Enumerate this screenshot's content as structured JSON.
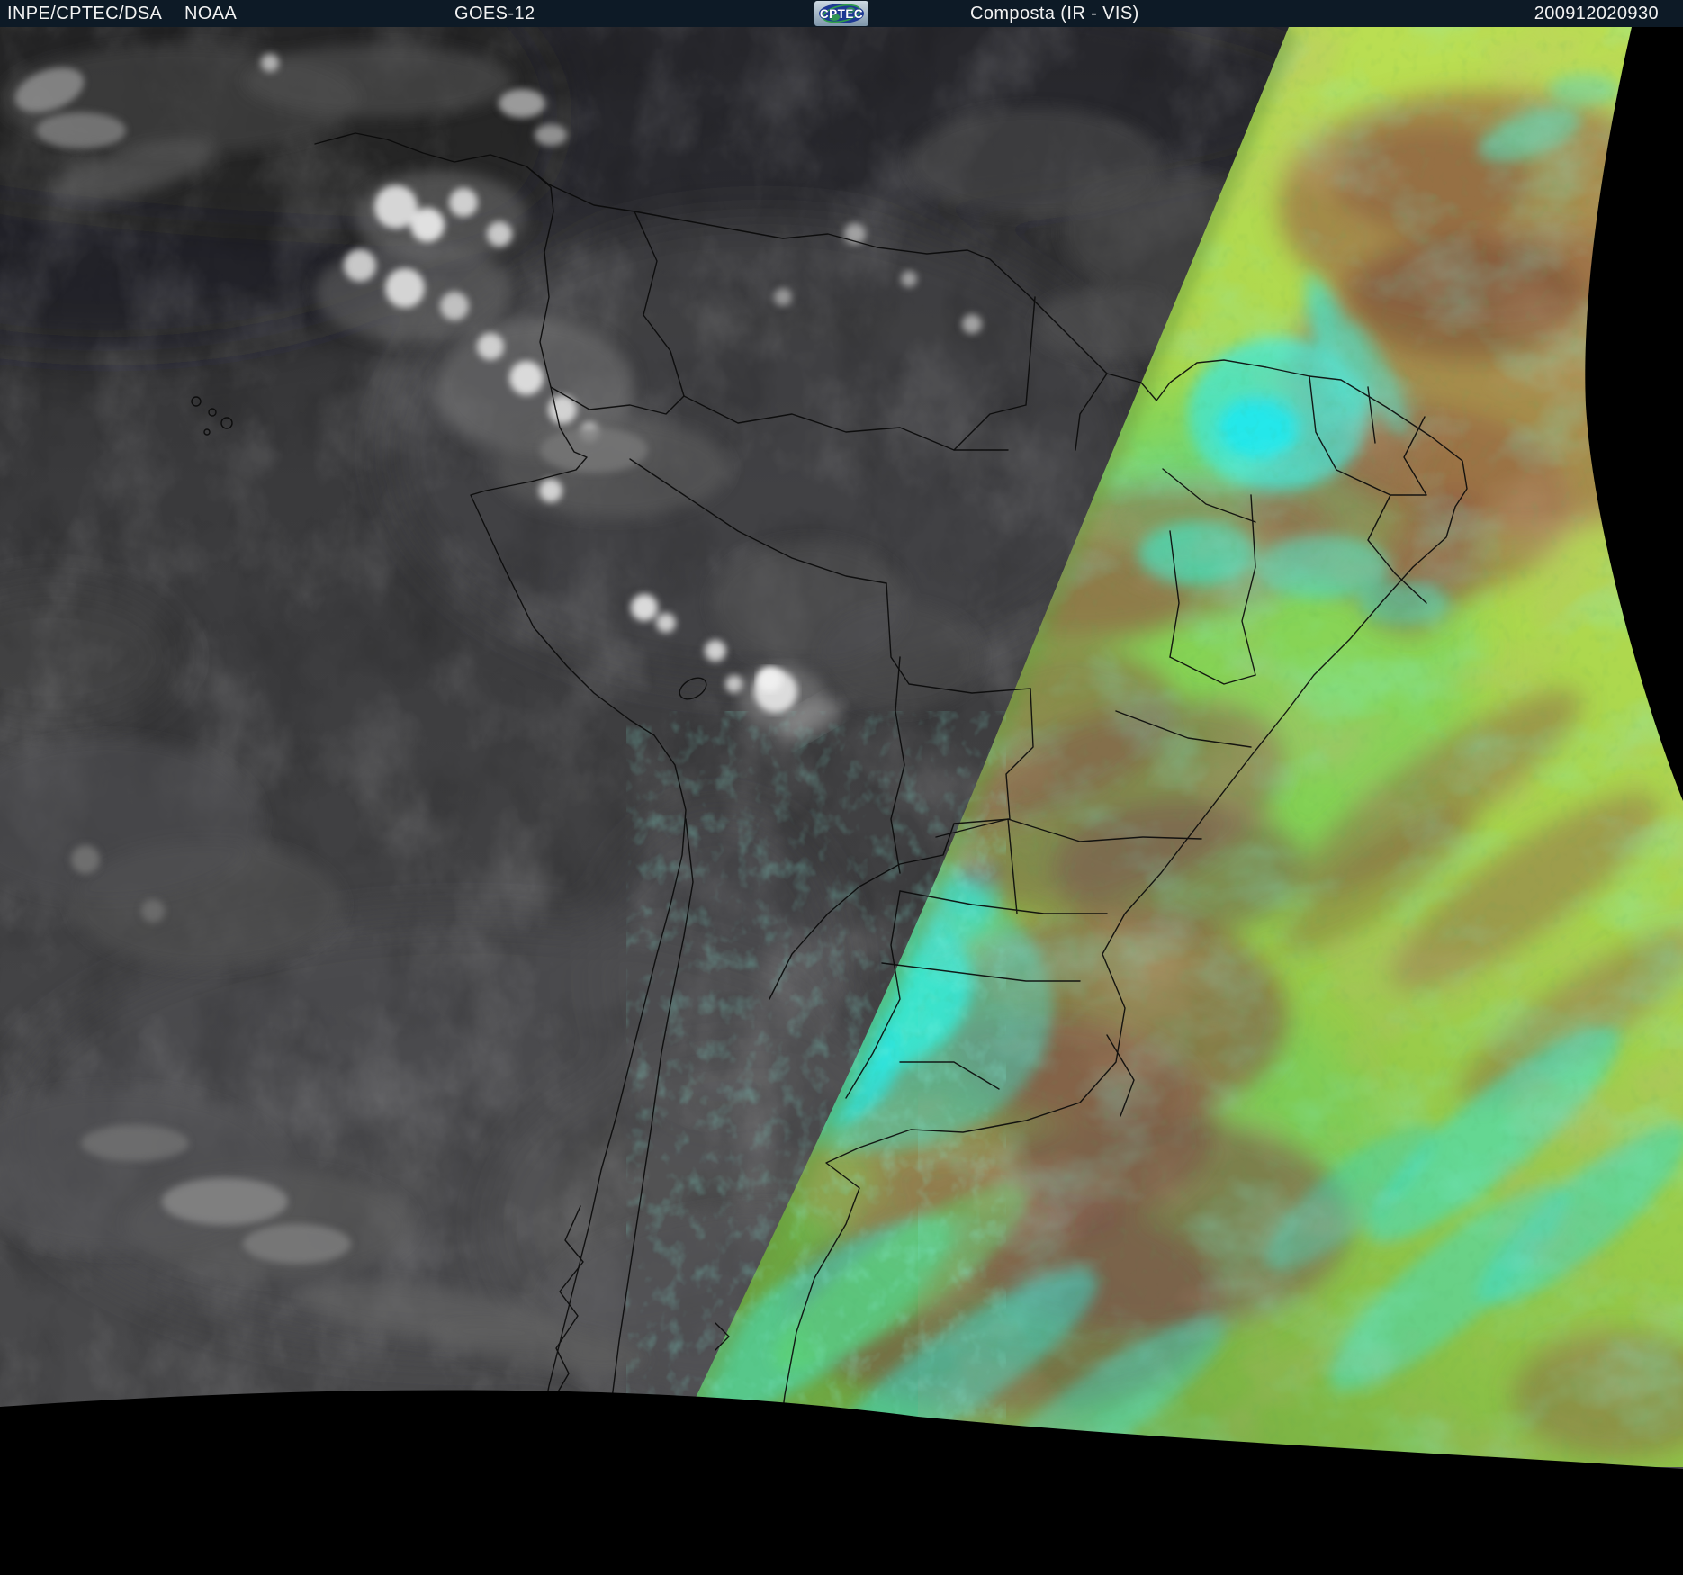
{
  "header": {
    "agency": "INPE/CPTEC/DSA",
    "noaa_label": "NOAA",
    "satellite": "GOES-12",
    "product": "Composta (IR - VIS)",
    "timestamp": "200912020930",
    "logo_text": "CPTEC",
    "bg_color": "#0d1a26",
    "text_color": "#f2f2f2"
  },
  "scene": {
    "kind": "geostationary-satellite-composite-image",
    "region": "South America",
    "night_side": "grayscale VIS/IR (west)",
    "day_side": "colorized IR-VIS composite (east)",
    "palette": {
      "space_black": "#000000",
      "night_ocean_gray": "#3e3e40",
      "night_cloud_bright": "#e6e6e6",
      "day_base_green": "#a5d44c",
      "day_yellow_green": "#bade52",
      "day_olive_edge": "#6fa843",
      "cold_cloud_cyan": "#3ce6d6",
      "warm_land_brown": "#9a6946",
      "low_cloud_maroon": "#7d5049",
      "border_line": "#0a0a0a"
    }
  }
}
